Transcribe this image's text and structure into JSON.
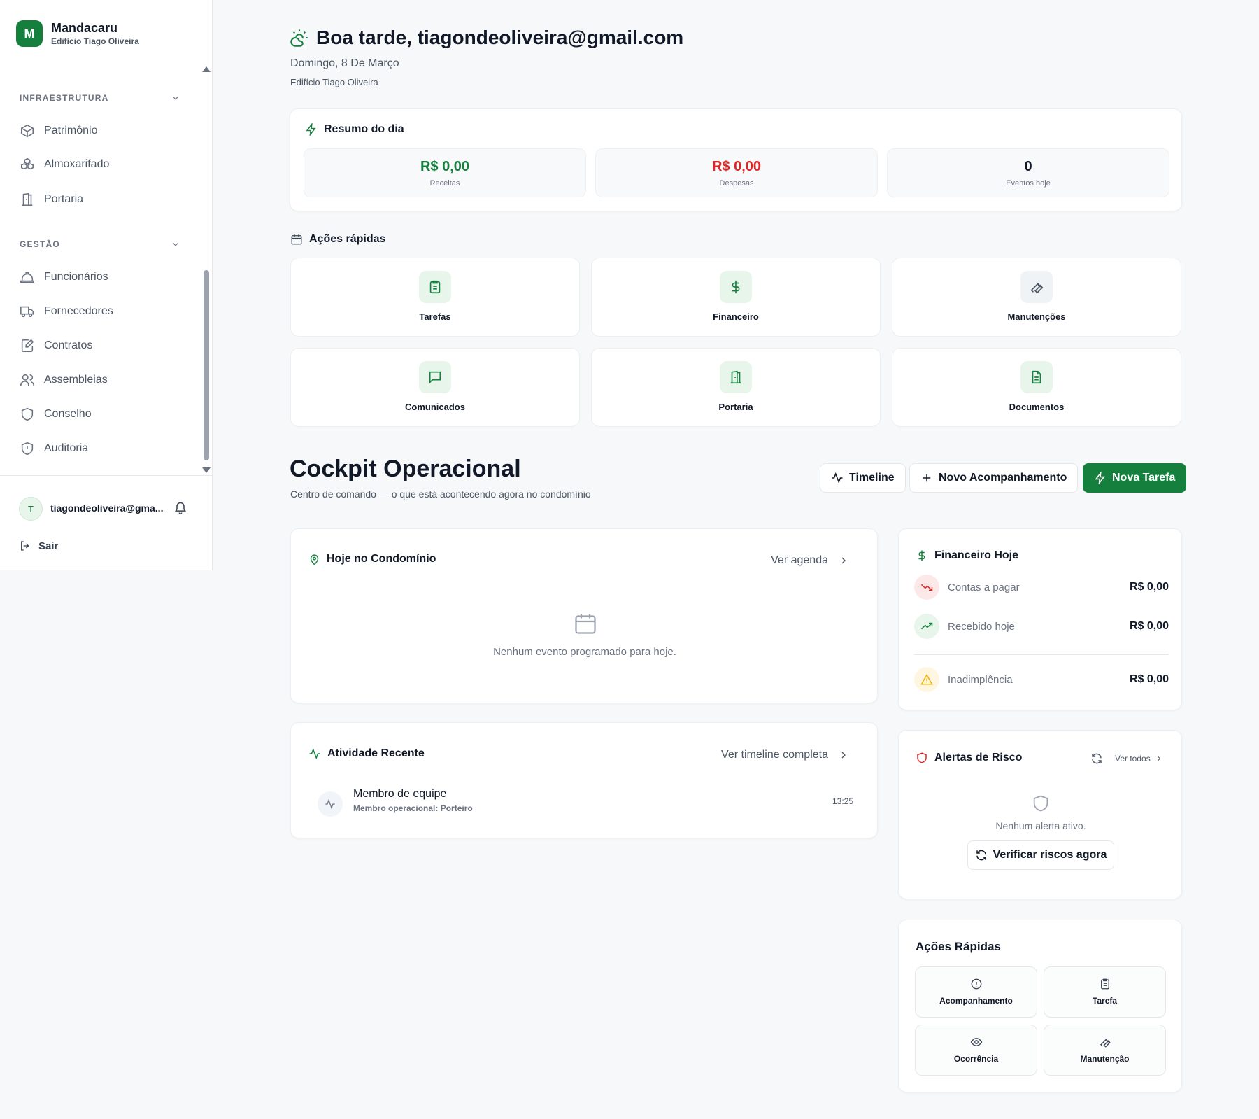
{
  "brand": {
    "initial": "M",
    "name": "Mandacaru",
    "subtitle": "Edifício Tiago Oliveira"
  },
  "sidebar": {
    "sections": [
      {
        "title": "INFRAESTRUTURA",
        "items": [
          {
            "label": "Patrimônio",
            "icon": "box-icon"
          },
          {
            "label": "Almoxarifado",
            "icon": "boxes-icon"
          },
          {
            "label": "Portaria",
            "icon": "door-icon"
          }
        ]
      },
      {
        "title": "GESTÃO",
        "items": [
          {
            "label": "Funcionários",
            "icon": "hard-hat-icon"
          },
          {
            "label": "Fornecedores",
            "icon": "truck-icon"
          },
          {
            "label": "Contratos",
            "icon": "file-edit-icon"
          },
          {
            "label": "Assembleias",
            "icon": "users-icon"
          },
          {
            "label": "Conselho",
            "icon": "shield-icon"
          },
          {
            "label": "Auditoria",
            "icon": "shield-alert-icon"
          }
        ]
      }
    ],
    "user": {
      "initial": "T",
      "email": "tiagondeoliveira@gma..."
    },
    "logout_label": "Sair"
  },
  "header": {
    "greeting": "Boa tarde, tiagondeoliveira@gmail.com",
    "date": "Domingo, 8 De Março",
    "building": "Edifício Tiago Oliveira"
  },
  "summary": {
    "title": "Resumo do dia",
    "stats": [
      {
        "value": "R$ 0,00",
        "label": "Receitas",
        "color": "#15803d"
      },
      {
        "value": "R$ 0,00",
        "label": "Despesas",
        "color": "#dc2626"
      },
      {
        "value": "0",
        "label": "Eventos hoje",
        "color": "#111827"
      }
    ]
  },
  "quick_actions": {
    "title": "Ações rápidas",
    "items": [
      {
        "label": "Tarefas",
        "icon": "clipboard-icon"
      },
      {
        "label": "Financeiro",
        "icon": "dollar-icon"
      },
      {
        "label": "Manutenções",
        "icon": "wrench-icon"
      },
      {
        "label": "Comunicados",
        "icon": "message-icon"
      },
      {
        "label": "Portaria",
        "icon": "door-icon"
      },
      {
        "label": "Documentos",
        "icon": "file-text-icon"
      }
    ]
  },
  "cockpit": {
    "title": "Cockpit Operacional",
    "subtitle": "Centro de comando — o que está acontecendo agora no condomínio",
    "buttons": {
      "timeline": "Timeline",
      "new_follow": "Novo Acompanhamento",
      "new_task": "Nova Tarefa"
    }
  },
  "today": {
    "title": "Hoje no Condomínio",
    "link": "Ver agenda",
    "empty": "Nenhum evento programado para hoje."
  },
  "activity": {
    "title": "Atividade Recente",
    "link": "Ver timeline completa",
    "items": [
      {
        "title": "Membro de equipe",
        "subtitle": "Membro operacional: Porteiro",
        "time": "13:25"
      }
    ]
  },
  "finance": {
    "title": "Financeiro Hoje",
    "rows": [
      {
        "label": "Contas a pagar",
        "value": "R$ 0,00"
      },
      {
        "label": "Recebido hoje",
        "value": "R$ 0,00"
      },
      {
        "label": "Inadimplência",
        "value": "R$ 0,00"
      }
    ]
  },
  "alerts": {
    "title": "Alertas de Risco",
    "link": "Ver todos",
    "empty": "Nenhum alerta ativo.",
    "button": "Verificar riscos agora"
  },
  "fast_actions": {
    "title": "Ações Rápidas",
    "items": [
      {
        "label": "Acompanhamento",
        "icon": "alert-circle-icon"
      },
      {
        "label": "Tarefa",
        "icon": "clipboard-icon"
      },
      {
        "label": "Ocorrência",
        "icon": "eye-icon"
      },
      {
        "label": "Manutenção",
        "icon": "wrench-icon"
      }
    ]
  },
  "colors": {
    "accent": "#15803d",
    "danger": "#dc2626",
    "warning": "#eab308"
  }
}
